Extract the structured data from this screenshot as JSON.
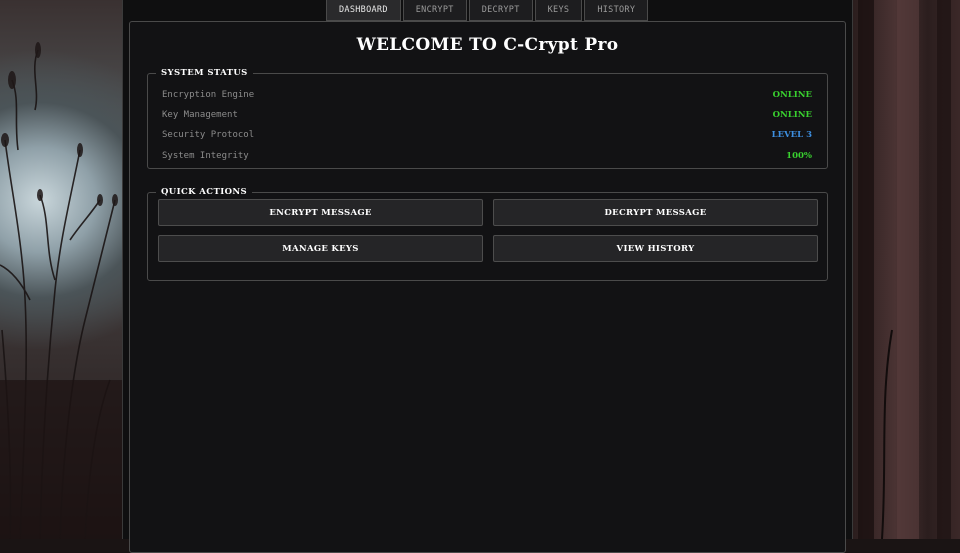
{
  "tabs": [
    {
      "label": "DASHBOARD",
      "active": true
    },
    {
      "label": "ENCRYPT",
      "active": false
    },
    {
      "label": "DECRYPT",
      "active": false
    },
    {
      "label": "KEYS",
      "active": false
    },
    {
      "label": "HISTORY",
      "active": false
    }
  ],
  "title": "WELCOME TO C-Crypt Pro",
  "system_status": {
    "legend": "SYSTEM STATUS",
    "rows": [
      {
        "label": "Encryption Engine",
        "value": "ONLINE",
        "color": "#39d12f"
      },
      {
        "label": "Key Management",
        "value": "ONLINE",
        "color": "#39d12f"
      },
      {
        "label": "Security Protocol",
        "value": "LEVEL 3",
        "color": "#3d8fe0"
      },
      {
        "label": "System Integrity",
        "value": "100%",
        "color": "#39d12f"
      }
    ]
  },
  "quick_actions": {
    "legend": "QUICK ACTIONS",
    "buttons": [
      "ENCRYPT MESSAGE",
      "DECRYPT MESSAGE",
      "MANAGE KEYS",
      "VIEW HISTORY"
    ]
  }
}
